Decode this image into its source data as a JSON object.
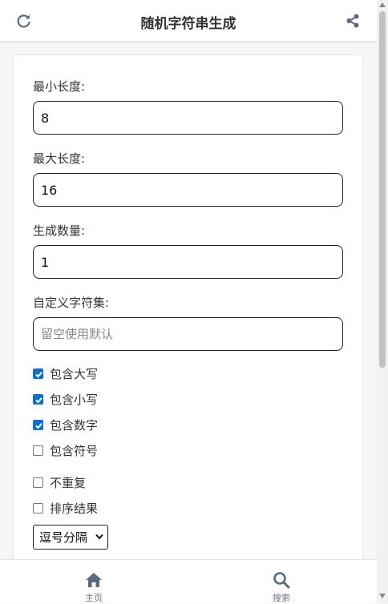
{
  "header": {
    "title": "随机字符串生成",
    "left_icon": "refresh-icon",
    "right_icon": "share-icon"
  },
  "form": {
    "min_length": {
      "label": "最小长度:",
      "value": "8"
    },
    "max_length": {
      "label": "最大长度:",
      "value": "16"
    },
    "count": {
      "label": "生成数量:",
      "value": "1"
    },
    "charset": {
      "label": "自定义字符集:",
      "value": "",
      "placeholder": "留空使用默认"
    },
    "checkboxes": [
      {
        "label": "包含大写",
        "checked": true
      },
      {
        "label": "包含小写",
        "checked": true
      },
      {
        "label": "包含数字",
        "checked": true
      },
      {
        "label": "包含符号",
        "checked": false
      },
      {
        "label": "不重复",
        "checked": false
      },
      {
        "label": "排序结果",
        "checked": false
      }
    ],
    "separator": {
      "selected": "逗号分隔"
    }
  },
  "bottom_nav": [
    {
      "label": "主页",
      "icon": "home-icon"
    },
    {
      "label": "搜索",
      "icon": "search-icon"
    }
  ],
  "colors": {
    "accent": "#0a6fd1",
    "nav_icon": "#5b6b7e"
  }
}
